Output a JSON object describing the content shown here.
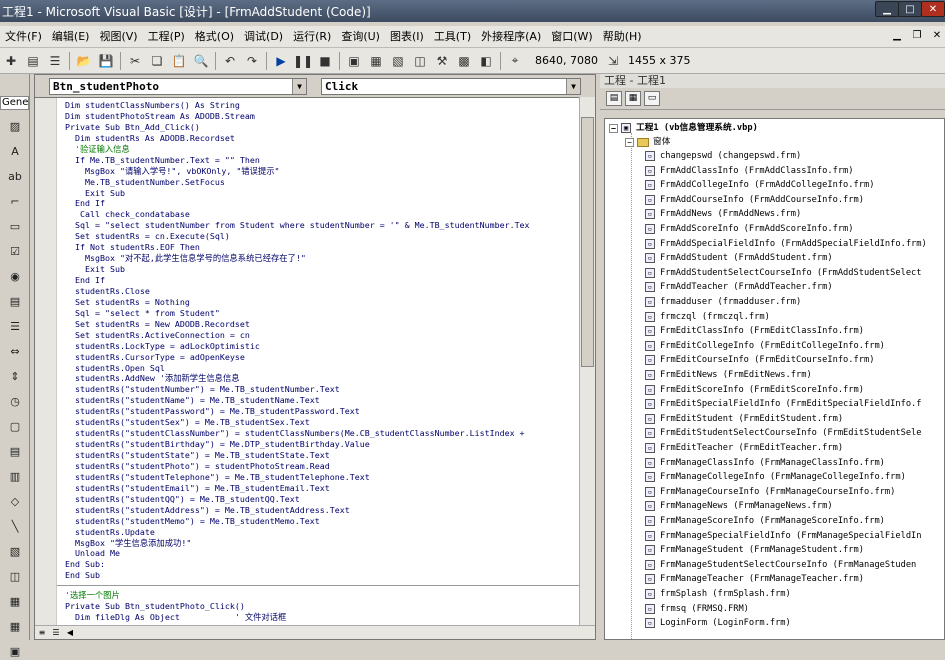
{
  "window": {
    "title": "工程1 - Microsoft Visual Basic [设计] - [FrmAddStudent (Code)]"
  },
  "menu": [
    "文件(F)",
    "编辑(E)",
    "视图(V)",
    "工程(P)",
    "格式(O)",
    "调试(D)",
    "运行(R)",
    "查询(U)",
    "图表(I)",
    "工具(T)",
    "外接程序(A)",
    "窗口(W)",
    "帮助(H)"
  ],
  "toolbar": {
    "position": "8640, 7080",
    "size": "1455 x 375"
  },
  "toolbox": {
    "tab_label": "General"
  },
  "code": {
    "object_combo": "Btn_studentPhoto",
    "proc_combo": "Click",
    "lines": [
      "Dim studentClassNumbers() As String",
      "Dim studentPhotoStream As ADODB.Stream",
      "Private Sub Btn_Add_Click()",
      "  Dim studentRs As ADODB.Recordset",
      "  '验证输入信息",
      "  If Me.TB_studentNumber.Text = \"\" Then",
      "    MsgBox \"请输入学号!\", vbOKOnly, \"错误提示\"",
      "    Me.TB_studentNumber.SetFocus",
      "    Exit Sub",
      "  End If",
      "   Call check_condatabase",
      "  Sql = \"select studentNumber from Student where studentNumber = '\" & Me.TB_studentNumber.Tex",
      "  Set studentRs = cn.Execute(Sql)",
      "  If Not studentRs.EOF Then",
      "    MsgBox \"对不起,此学生信息学号的信息系统已经存在了!\"",
      "    Exit Sub",
      "  End If",
      "  studentRs.Close",
      "  Set studentRs = Nothing",
      "  Sql = \"select * from Student\"",
      "  Set studentRs = New ADODB.Recordset",
      "  Set studentRs.ActiveConnection = cn",
      "  studentRs.LockType = adLockOptimistic",
      "  studentRs.CursorType = adOpenKeyse",
      "  studentRs.Open Sql",
      "  studentRs.AddNew '添加新学生信息信息",
      "  studentRs(\"studentNumber\") = Me.TB_studentNumber.Text",
      "  studentRs(\"studentName\") = Me.TB_studentName.Text",
      "  studentRs(\"studentPassword\") = Me.TB_studentPassword.Text",
      "  studentRs(\"studentSex\") = Me.TB_studentSex.Text",
      "  studentRs(\"studentClassNumber\") = studentClassNumbers(Me.CB_studentClassNumber.ListIndex +",
      "  studentRs(\"studentBirthday\") = Me.DTP_studentBirthday.Value",
      "  studentRs(\"studentState\") = Me.TB_studentState.Text",
      "  studentRs(\"studentPhoto\") = studentPhotoStream.Read",
      "  studentRs(\"studentTelephone\") = Me.TB_studentTelephone.Text",
      "  studentRs(\"studentEmail\") = Me.TB_studentEmail.Text",
      "  studentRs(\"studentQQ\") = Me.TB_studentQQ.Text",
      "  studentRs(\"studentAddress\") = Me.TB_studentAddress.Text",
      "  studentRs(\"studentMemo\") = Me.TB_studentMemo.Text",
      "  studentRs.Update",
      "  MsgBox \"学生信息添加成功!\"",
      "  Unload Me",
      "End Sub:",
      "End Sub"
    ],
    "lines_after": [
      "'选择一个图片",
      "Private Sub Btn_studentPhoto_Click()",
      "  Dim fileDlg As Object           ' 文件对话框"
    ]
  },
  "project": {
    "title": "工程 - 工程1",
    "root": "工程1 (vb信息管理系统.vbp)",
    "folder": "窗体",
    "items": [
      "changepswd (changepswd.frm)",
      "FrmAddClassInfo (FrmAddClassInfo.frm)",
      "FrmAddCollegeInfo (FrmAddCollegeInfo.frm)",
      "FrmAddCourseInfo (FrmAddCourseInfo.frm)",
      "FrmAddNews (FrmAddNews.frm)",
      "FrmAddScoreInfo (FrmAddScoreInfo.frm)",
      "FrmAddSpecialFieldInfo (FrmAddSpecialFieldInfo.frm)",
      "FrmAddStudent (FrmAddStudent.frm)",
      "FrmAddStudentSelectCourseInfo (FrmAddStudentSelect",
      "FrmAddTeacher (FrmAddTeacher.frm)",
      "frmadduser (frmadduser.frm)",
      "frmczql (frmczql.frm)",
      "FrmEditClassInfo (FrmEditClassInfo.frm)",
      "FrmEditCollegeInfo (FrmEditCollegeInfo.frm)",
      "FrmEditCourseInfo (FrmEditCourseInfo.frm)",
      "FrmEditNews (FrmEditNews.frm)",
      "FrmEditScoreInfo (FrmEditScoreInfo.frm)",
      "FrmEditSpecialFieldInfo (FrmEditSpecialFieldInfo.f",
      "FrmEditStudent (FrmEditStudent.frm)",
      "FrmEditStudentSelectCourseInfo (FrmEditStudentSele",
      "FrmEditTeacher (FrmEditTeacher.frm)",
      "FrmManageClassInfo (FrmManageClassInfo.frm)",
      "FrmManageCollegeInfo (FrmManageCollegeInfo.frm)",
      "FrmManageCourseInfo (FrmManageCourseInfo.frm)",
      "FrmManageNews (FrmManageNews.frm)",
      "FrmManageScoreInfo (FrmManageScoreInfo.frm)",
      "FrmManageSpecialFieldInfo (FrmManageSpecialFieldIn",
      "FrmManageStudent (FrmManageStudent.frm)",
      "FrmManageStudentSelectCourseInfo (FrmManageStuden",
      "FrmManageTeacher (FrmManageTeacher.frm)",
      "frmSplash (frmSplash.frm)",
      "frmsq (FRMSQ.FRM)",
      "LoginForm (LoginForm.frm)"
    ]
  }
}
